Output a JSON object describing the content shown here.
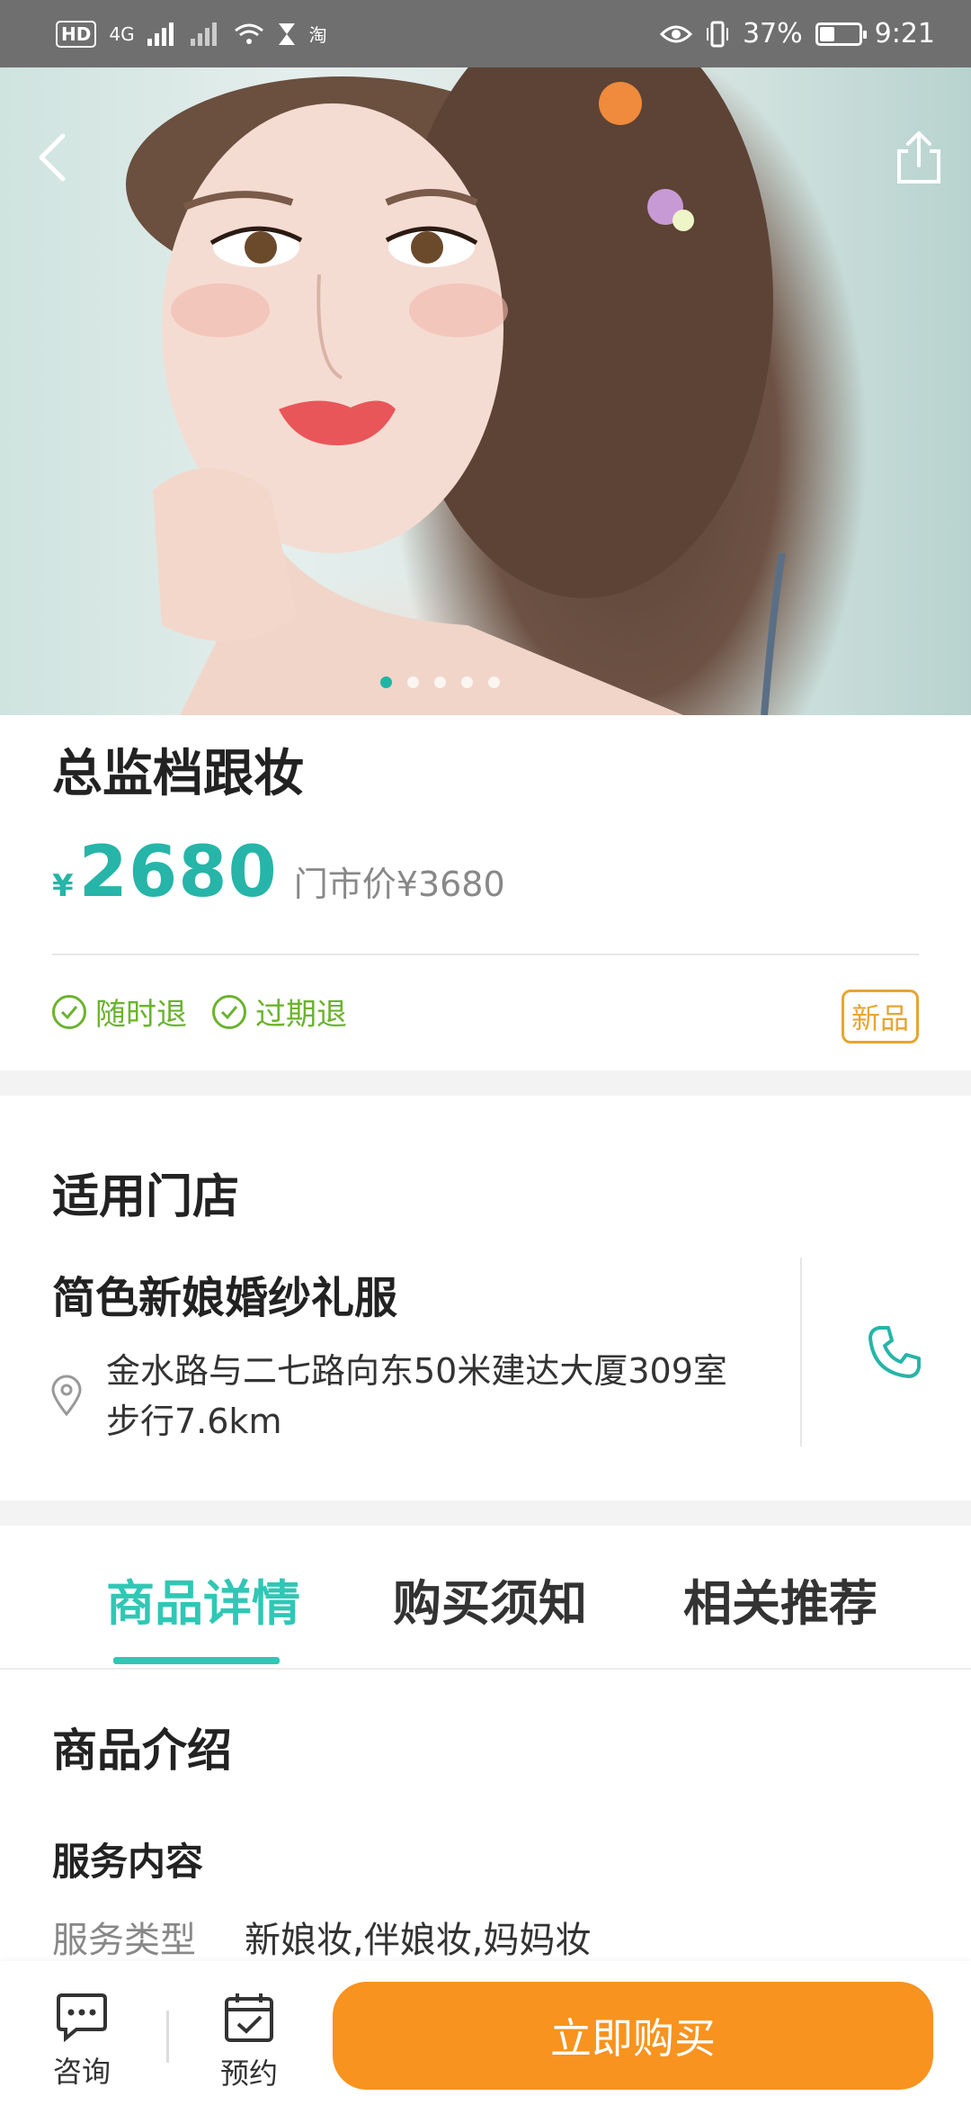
{
  "status_bar": {
    "left_badge": "HD",
    "network": "4G",
    "app_icon": "淘",
    "battery_text": "37%",
    "battery_level": 0.37,
    "time": "9:21"
  },
  "hero": {
    "carousel_count": 5,
    "active_index": 0
  },
  "product": {
    "title": "总监档跟妆",
    "currency": "¥",
    "price": "2680",
    "original_label": "门市价",
    "original_price": "¥3680",
    "tags": [
      "随时退",
      "过期退"
    ],
    "badge": "新品"
  },
  "store": {
    "heading": "适用门店",
    "name": "简色新娘婚纱礼服",
    "address": "金水路与二七路向东50米建达大厦309室",
    "distance": "步行7.6km"
  },
  "tabs": [
    {
      "label": "商品详情",
      "active": true
    },
    {
      "label": "购买须知",
      "active": false
    },
    {
      "label": "相关推荐",
      "active": false
    }
  ],
  "details": {
    "heading": "商品介绍",
    "subheading": "服务内容",
    "rows": [
      {
        "key": "服务类型",
        "value": "新娘妆,伴娘妆,妈妈妆"
      }
    ]
  },
  "bottom_bar": {
    "consult_label": "咨询",
    "reserve_label": "预约",
    "buy_label": "立即购买"
  },
  "colors": {
    "accent": "#26b5a8",
    "tag_green": "#6bb32e",
    "badge_orange": "#e8a531",
    "buy_orange": "#f7931e"
  },
  "icons": [
    "back-arrow-icon",
    "share-icon",
    "check-circle-icon",
    "location-pin-icon",
    "phone-icon",
    "chat-icon",
    "calendar-check-icon"
  ]
}
